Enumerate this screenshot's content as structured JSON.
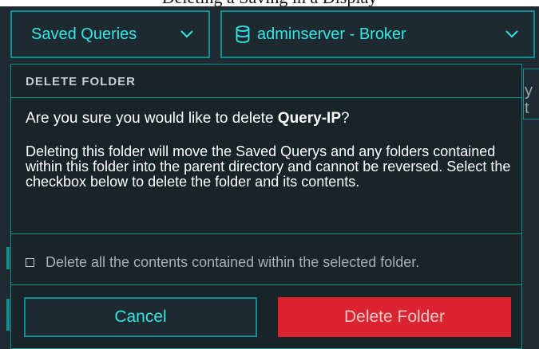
{
  "caption": "Deleting a Saving in a Display",
  "header": {
    "saved_queries_label": "Saved Queries",
    "server_label": "adminserver - Broker"
  },
  "background": {
    "partial_text": "y t"
  },
  "dialog": {
    "title": "DELETE FOLDER",
    "question_prefix": "Are you sure you would like to delete ",
    "folder_name": "Query-IP",
    "question_suffix": "?",
    "description": "Deleting this folder will move the Saved Querys and any folders contained within this folder into the parent directory and cannot be reversed. Select the checkbox below to delete the folder and its contents.",
    "checkbox_label": "Delete all the contents contained within the selected folder.",
    "checkbox_checked": false,
    "cancel_label": "Cancel",
    "delete_label": "Delete Folder"
  },
  "colors": {
    "accent": "#33e7e6",
    "border": "#0e8f92",
    "background": "#1f2b31",
    "danger": "#dc2430"
  }
}
